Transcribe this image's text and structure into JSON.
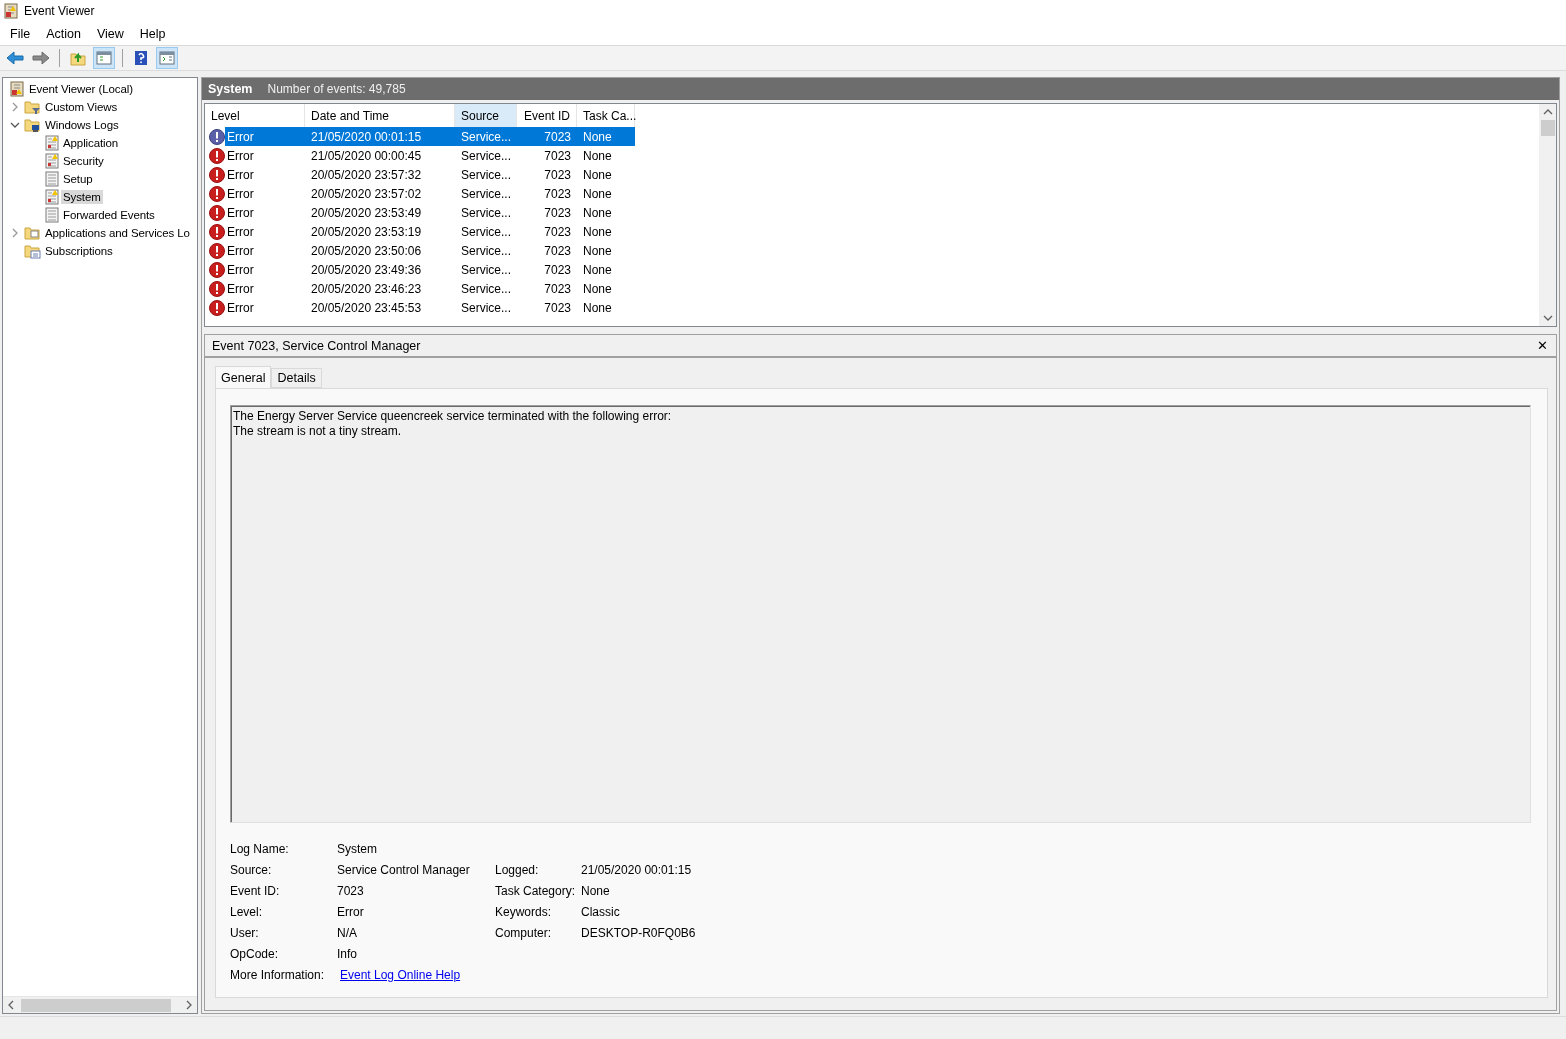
{
  "window": {
    "title": "Event Viewer"
  },
  "menu": [
    "File",
    "Action",
    "View",
    "Help"
  ],
  "tree": [
    {
      "label": "Event Viewer (Local)",
      "kind": "root",
      "selected": false,
      "children": [
        {
          "label": "Custom Views",
          "kind": "filter-folder",
          "selected": false,
          "expanded": false
        },
        {
          "label": "Windows Logs",
          "kind": "logs-folder",
          "selected": false,
          "expanded": true,
          "children": [
            {
              "label": "Application",
              "kind": "warn-log",
              "selected": false
            },
            {
              "label": "Security",
              "kind": "warn-log",
              "selected": false
            },
            {
              "label": "Setup",
              "kind": "log",
              "selected": false
            },
            {
              "label": "System",
              "kind": "warn-log",
              "selected": true
            },
            {
              "label": "Forwarded Events",
              "kind": "log",
              "selected": false
            }
          ]
        },
        {
          "label": "Applications and Services Lo",
          "kind": "folder",
          "selected": false,
          "expanded": false
        },
        {
          "label": "Subscriptions",
          "kind": "subs-folder",
          "selected": false
        }
      ]
    }
  ],
  "log_header": {
    "title": "System",
    "count": "Number of events: 49,785"
  },
  "table": {
    "columns": [
      {
        "label": "Level",
        "sorted": false
      },
      {
        "label": "Date and Time",
        "sorted": false
      },
      {
        "label": "Source",
        "sorted": true
      },
      {
        "label": "Event ID",
        "sorted": false
      },
      {
        "label": "Task Ca...",
        "sorted": false
      }
    ],
    "rows": [
      {
        "level": "Error",
        "time": "21/05/2020 00:01:15",
        "source": "Service...",
        "event_id": "7023",
        "task": "None",
        "selected": true
      },
      {
        "level": "Error",
        "time": "21/05/2020 00:00:45",
        "source": "Service...",
        "event_id": "7023",
        "task": "None",
        "selected": false
      },
      {
        "level": "Error",
        "time": "20/05/2020 23:57:32",
        "source": "Service...",
        "event_id": "7023",
        "task": "None",
        "selected": false
      },
      {
        "level": "Error",
        "time": "20/05/2020 23:57:02",
        "source": "Service...",
        "event_id": "7023",
        "task": "None",
        "selected": false
      },
      {
        "level": "Error",
        "time": "20/05/2020 23:53:49",
        "source": "Service...",
        "event_id": "7023",
        "task": "None",
        "selected": false
      },
      {
        "level": "Error",
        "time": "20/05/2020 23:53:19",
        "source": "Service...",
        "event_id": "7023",
        "task": "None",
        "selected": false
      },
      {
        "level": "Error",
        "time": "20/05/2020 23:50:06",
        "source": "Service...",
        "event_id": "7023",
        "task": "None",
        "selected": false
      },
      {
        "level": "Error",
        "time": "20/05/2020 23:49:36",
        "source": "Service...",
        "event_id": "7023",
        "task": "None",
        "selected": false
      },
      {
        "level": "Error",
        "time": "20/05/2020 23:46:23",
        "source": "Service...",
        "event_id": "7023",
        "task": "None",
        "selected": false
      },
      {
        "level": "Error",
        "time": "20/05/2020 23:45:53",
        "source": "Service...",
        "event_id": "7023",
        "task": "None",
        "selected": false
      }
    ]
  },
  "detail": {
    "title": "Event 7023, Service Control Manager",
    "close": "✕",
    "tabs": [
      {
        "label": "General",
        "selected": true
      },
      {
        "label": "Details",
        "selected": false
      }
    ],
    "message": "The Energy Server Service queencreek service terminated with the following error: \nThe stream is not a tiny stream.",
    "fields_left": [
      {
        "label": "Log Name:",
        "value": "System"
      },
      {
        "label": "Source:",
        "value": "Service Control Manager"
      },
      {
        "label": "Event ID:",
        "value": "7023"
      },
      {
        "label": "Level:",
        "value": "Error"
      },
      {
        "label": "User:",
        "value": "N/A"
      },
      {
        "label": "OpCode:",
        "value": "Info"
      }
    ],
    "fields_right": [
      {
        "label": "Logged:",
        "value": "21/05/2020 00:01:15"
      },
      {
        "label": "Task Category:",
        "value": "None"
      },
      {
        "label": "Keywords:",
        "value": "Classic"
      },
      {
        "label": "Computer:",
        "value": "DESKTOP-R0FQ0B6"
      }
    ],
    "more_info": {
      "label": "More Information:",
      "link": "Event Log Online Help"
    }
  }
}
